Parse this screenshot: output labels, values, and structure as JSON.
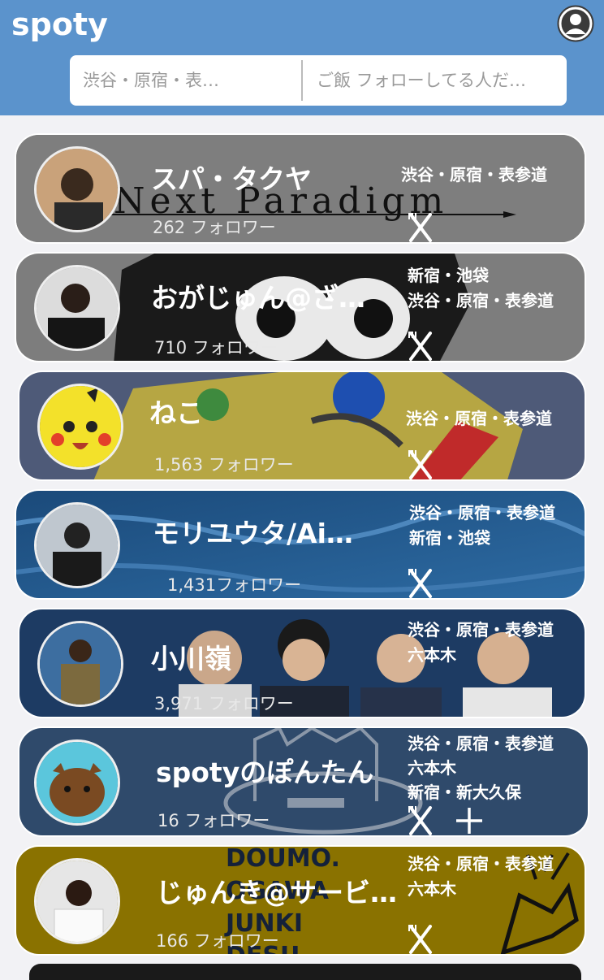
{
  "app": {
    "logo": "spoty"
  },
  "search": {
    "area_placeholder": "渋谷・原宿・表…",
    "keyword_placeholder": "ご飯 フォローしてる人だ…"
  },
  "cards": [
    {
      "name": "スパ・タクヤ",
      "followers": "262 フォロワー",
      "areas": [
        "渋谷・原宿・表参道"
      ],
      "bg_text": "Next Paradigm",
      "bg_color": "#7d7d7d"
    },
    {
      "name": "おがじゅん@ざ…",
      "followers": "710 フォロワー",
      "areas": [
        "新宿・池袋",
        "渋谷・原宿・表参道"
      ],
      "bg_color": "#7d7d7d"
    },
    {
      "name": "ねこ",
      "followers": "1,563 フォロワー",
      "areas": [
        "渋谷・原宿・表参道"
      ],
      "bg_color": "#4e5a78"
    },
    {
      "name": "モリユウタ/Ai…",
      "followers": "1,431フォロワー",
      "areas": [
        "渋谷・原宿・表参道",
        "新宿・池袋"
      ],
      "bg_color": "#1f4d7a"
    },
    {
      "name": "小川嶺",
      "followers": "3,971 フォロワー",
      "areas": [
        "渋谷・原宿・表参道",
        "六本木"
      ],
      "bg_color": "#1d3b63"
    },
    {
      "name": "spotyのぽんたん",
      "followers": "16 フォロワー",
      "areas": [
        "渋谷・原宿・表参道",
        "六本木",
        "新宿・新大久保"
      ],
      "bg_color": "#2f4a6b"
    },
    {
      "name": "じゅんき@サービ…",
      "followers": "166 フォロワー",
      "areas": [
        "渋谷・原宿・表参道",
        "六本木"
      ],
      "bg_text": "DOUMO. OGAWA JUNKI DESU",
      "bg_color": "#8a7200"
    }
  ]
}
